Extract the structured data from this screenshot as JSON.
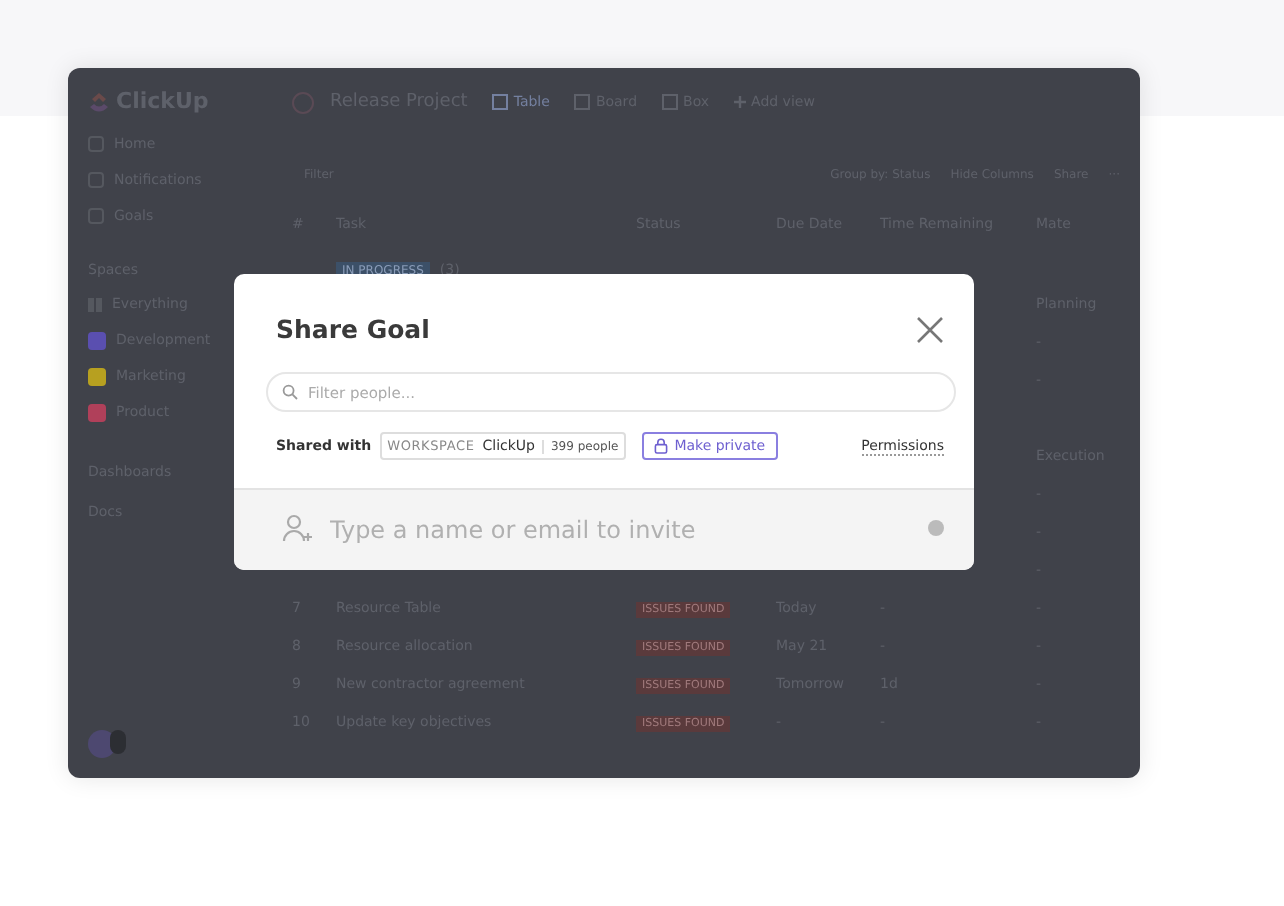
{
  "app": {
    "logo": "ClickUp",
    "project": "Release Project",
    "views": [
      {
        "label": "Table",
        "selected": true
      },
      {
        "label": "Board",
        "selected": false
      },
      {
        "label": "Box",
        "selected": false
      }
    ],
    "add_view": "Add view",
    "sidebar": {
      "nav": [
        "Home",
        "Notifications",
        "Goals"
      ],
      "spaces_heading": "Spaces",
      "spaces": [
        {
          "label": "Everything",
          "kind": "all"
        },
        {
          "label": "Development",
          "kind": "space",
          "color": "#5a4fb0"
        },
        {
          "label": "Marketing",
          "kind": "space",
          "color": "#b7a020"
        },
        {
          "label": "Product",
          "kind": "space",
          "color": "#b0405a"
        }
      ],
      "sections": [
        "Dashboards",
        "Docs"
      ]
    },
    "toolbar": {
      "filter": "Filter",
      "group_by": "Group by: Status",
      "hide_columns": "Hide Columns",
      "share": "Share",
      "more": "···"
    },
    "table": {
      "columns": [
        "#",
        "Task",
        "Status",
        "Due Date",
        "Time Remaining",
        "Mate"
      ],
      "group": {
        "label": "IN PROGRESS",
        "count": "(3)"
      },
      "rows": [
        {
          "kind": "task",
          "column_6": "Planning"
        },
        {
          "kind": "task",
          "column_6": "-"
        },
        {
          "kind": "task",
          "column_6": "-"
        },
        {
          "kind": "gap"
        },
        {
          "kind": "task",
          "column_6": "Execution"
        },
        {
          "kind": "task",
          "column_6": "-"
        },
        {
          "kind": "task",
          "column_6": "-"
        },
        {
          "kind": "task",
          "column_6": "-"
        },
        {
          "kind": "task",
          "number": "7",
          "task": "Resource Table",
          "status": "ISSUES FOUND",
          "due": "Today",
          "remaining": "-",
          "column_6": "-"
        },
        {
          "kind": "task",
          "number": "8",
          "task": "Resource allocation",
          "status": "ISSUES FOUND",
          "due": "May 21",
          "remaining": "-",
          "column_6": "-"
        },
        {
          "kind": "task",
          "number": "9",
          "task": "New contractor agreement",
          "status": "ISSUES FOUND",
          "due": "Tomorrow",
          "remaining": "1d",
          "column_6": "-"
        },
        {
          "kind": "task",
          "number": "10",
          "task": "Update key objectives",
          "status": "ISSUES FOUND",
          "due": "-",
          "remaining": "-",
          "column_6": "-"
        }
      ]
    }
  },
  "dialog": {
    "title": "Share Goal",
    "search": {
      "placeholder": "Filter people..."
    },
    "shared_with": "Shared with",
    "workspace_label": "WORKSPACE",
    "workspace": "ClickUp",
    "people": "399 people",
    "make_private": "Make private",
    "permissions": "Permissions",
    "invite": {
      "placeholder": "Type a name or email to invite"
    }
  }
}
